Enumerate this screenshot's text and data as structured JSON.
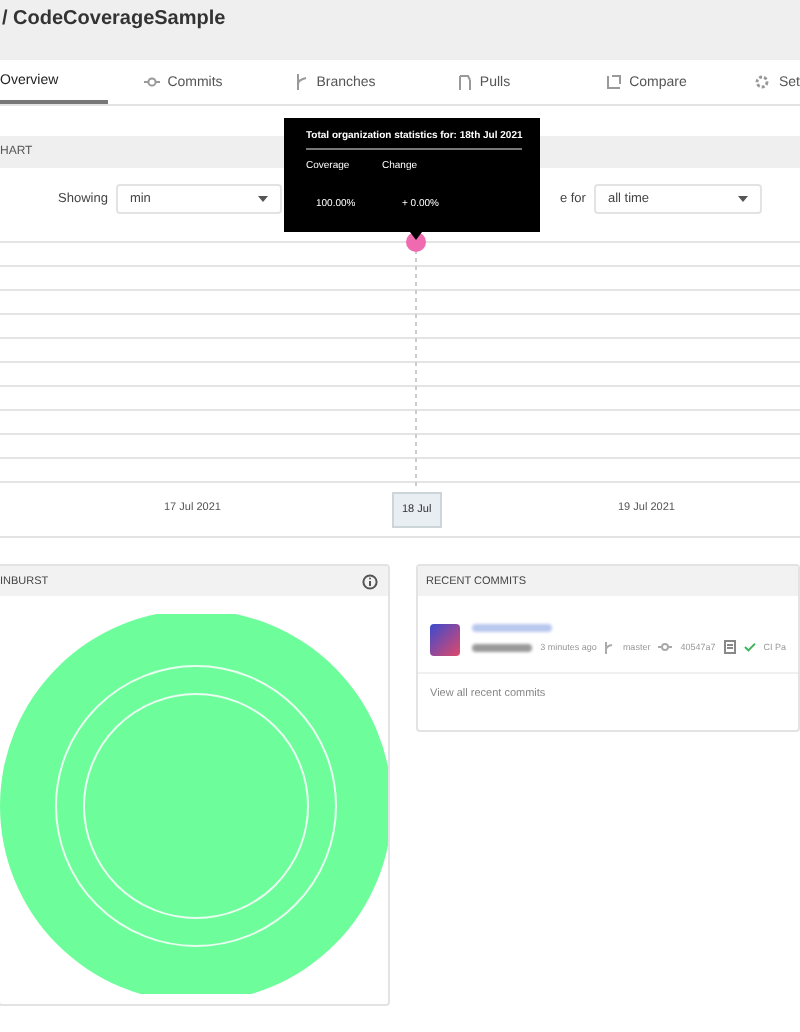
{
  "header": {
    "title": "/ CodeCoverageSample"
  },
  "tabs": [
    {
      "label": "Overview",
      "selected": true
    },
    {
      "label": "Commits",
      "selected": false
    },
    {
      "label": "Branches",
      "selected": false
    },
    {
      "label": "Pulls",
      "selected": false
    },
    {
      "label": "Compare",
      "selected": false
    },
    {
      "label": "Set",
      "selected": false
    }
  ],
  "chart_section": {
    "title": "HART",
    "showing_label": "Showing",
    "showing_value": "min",
    "range_label": "e for",
    "range_value": "all time",
    "tooltip": {
      "title": "Total organization statistics for: 18th Jul 2021",
      "columns": [
        "Coverage",
        "Change"
      ],
      "values": [
        "100.00%",
        "+ 0.00%"
      ]
    },
    "x_labels": [
      {
        "text": "17 Jul 2021",
        "selected": false
      },
      {
        "text": "18 Jul",
        "selected": true
      },
      {
        "text": "19 Jul 2021",
        "selected": false
      }
    ]
  },
  "sunburst": {
    "title": "INBURST"
  },
  "recent_commits": {
    "title": "RECENT COMMITS",
    "commits": [
      {
        "time": "3 minutes ago",
        "branch": "master",
        "sha": "40547a7",
        "status": "CI Pa"
      }
    ],
    "footer_link": "View all recent commits"
  }
}
